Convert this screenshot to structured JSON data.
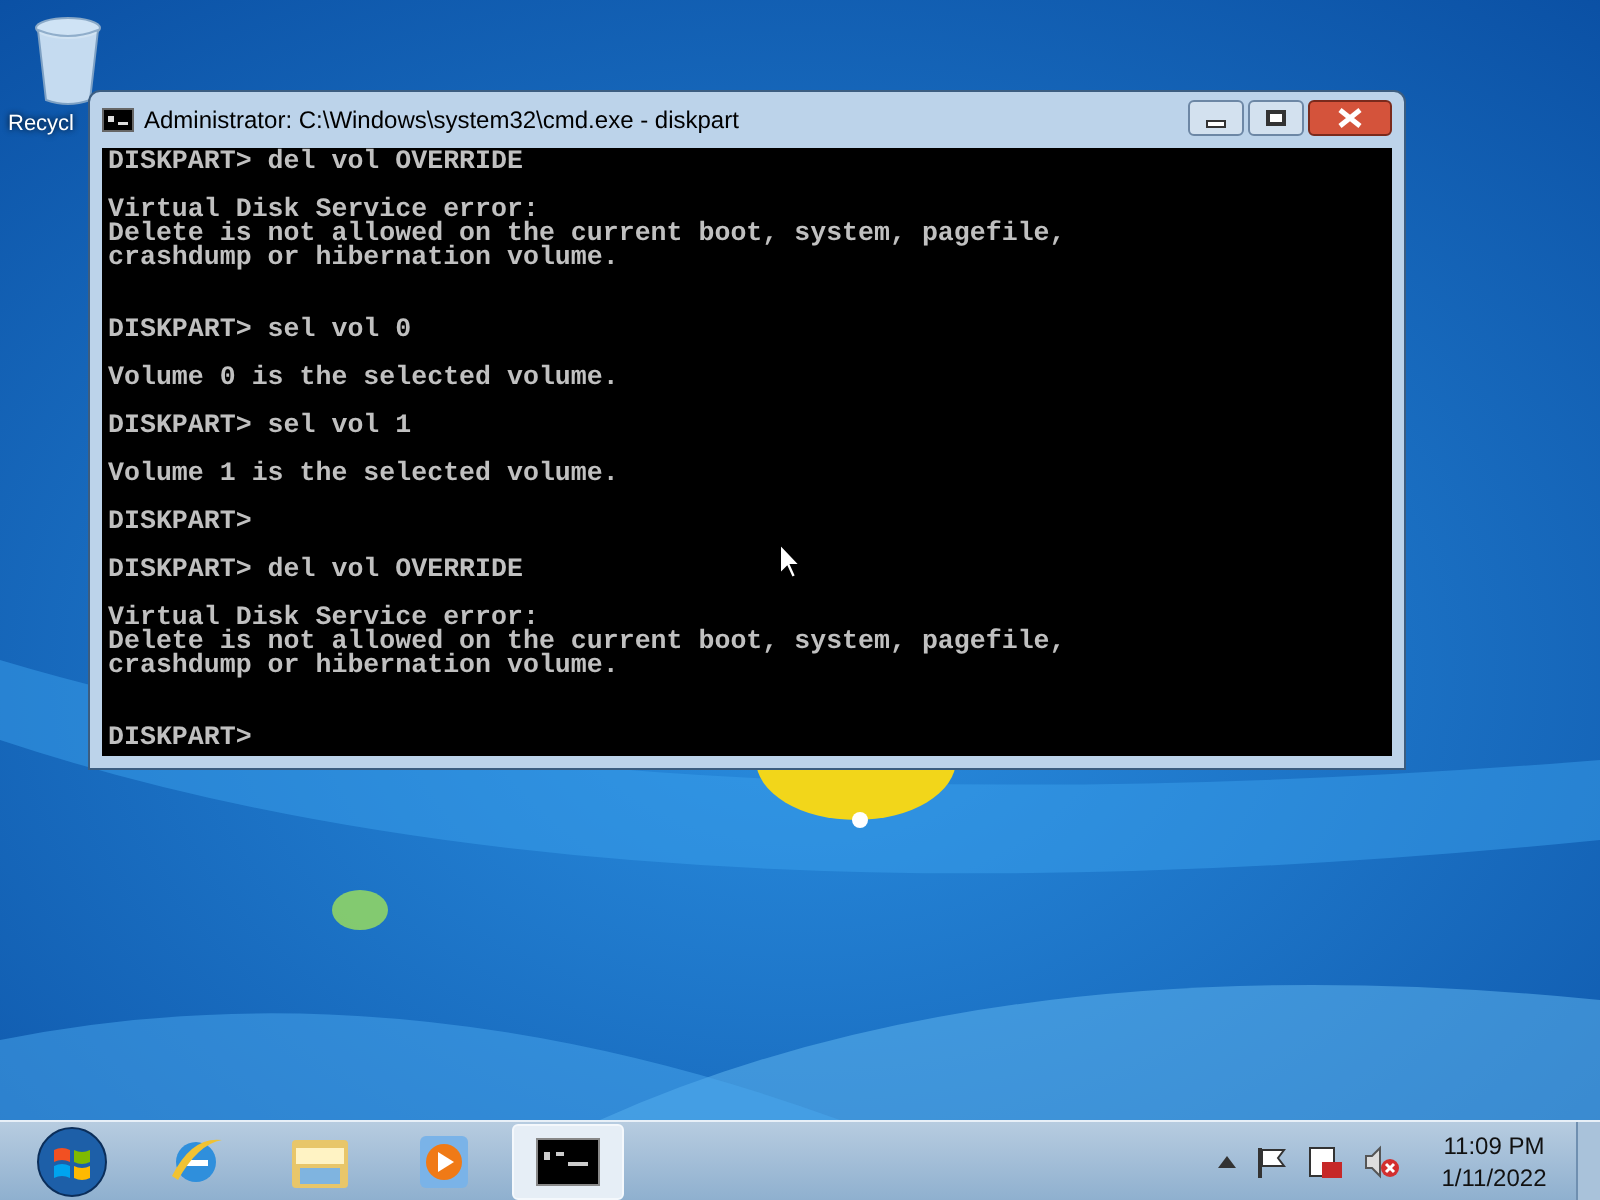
{
  "desktop_icons": [
    {
      "label": "Recycl"
    }
  ],
  "window": {
    "title": "Administrator: C:\\Windows\\system32\\cmd.exe - diskpart"
  },
  "console": {
    "lines": [
      {
        "kind": "text",
        "text": "DISKPART> del vol OVERRIDE"
      },
      {
        "kind": "blank"
      },
      {
        "kind": "text",
        "text": "Virtual Disk Service error:"
      },
      {
        "kind": "text",
        "text": "Delete is not allowed on the current boot, system, pagefile,"
      },
      {
        "kind": "text",
        "text": "crashdump or hibernation volume."
      },
      {
        "kind": "blank"
      },
      {
        "kind": "blank"
      },
      {
        "kind": "text",
        "text": "DISKPART> sel vol 0"
      },
      {
        "kind": "blank"
      },
      {
        "kind": "text",
        "text": "Volume 0 is the selected volume."
      },
      {
        "kind": "blank"
      },
      {
        "kind": "text",
        "text": "DISKPART> sel vol 1"
      },
      {
        "kind": "blank"
      },
      {
        "kind": "text",
        "text": "Volume 1 is the selected volume."
      },
      {
        "kind": "blank"
      },
      {
        "kind": "text",
        "text": "DISKPART>"
      },
      {
        "kind": "blank"
      },
      {
        "kind": "text",
        "text": "DISKPART> del vol OVERRIDE"
      },
      {
        "kind": "blank"
      },
      {
        "kind": "text",
        "text": "Virtual Disk Service error:"
      },
      {
        "kind": "text",
        "text": "Delete is not allowed on the current boot, system, pagefile,"
      },
      {
        "kind": "text",
        "text": "crashdump or hibernation volume."
      },
      {
        "kind": "blank"
      },
      {
        "kind": "blank"
      },
      {
        "kind": "text",
        "text": "DISKPART>"
      }
    ]
  },
  "taskbar": {
    "items": [
      {
        "kind": "start",
        "selected": false
      },
      {
        "kind": "browser",
        "selected": false
      },
      {
        "kind": "folder",
        "selected": false
      },
      {
        "kind": "media",
        "selected": false
      },
      {
        "kind": "console",
        "selected": true
      }
    ]
  },
  "tray": {
    "time": "11:09 PM",
    "date": "1/11/2022"
  }
}
